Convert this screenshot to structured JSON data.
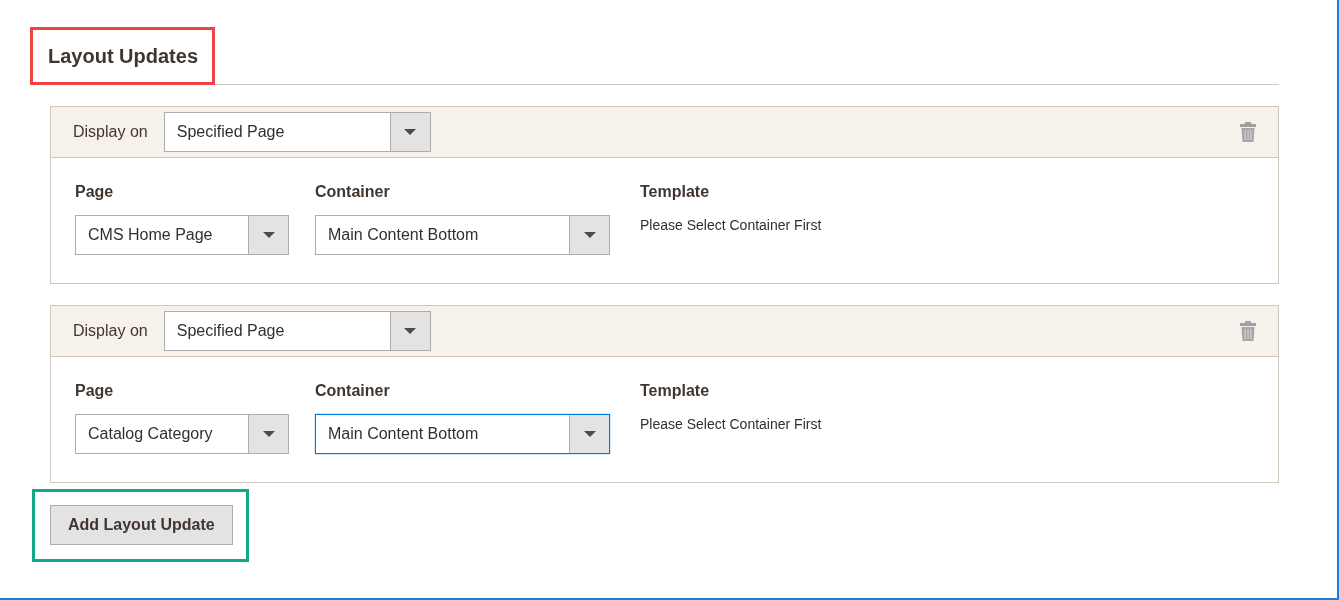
{
  "section": {
    "title": "Layout Updates",
    "title_highlight": {
      "color": "#ef4444"
    }
  },
  "layout_updates": [
    {
      "display_on": {
        "label": "Display on",
        "value": "Specified Page"
      },
      "fields": [
        {
          "label": "Page",
          "value": "CMS Home Page",
          "focused": false
        },
        {
          "label": "Container",
          "value": "Main Content Bottom",
          "focused": false
        }
      ],
      "template": {
        "label": "Template",
        "text": "Please Select Container First"
      }
    },
    {
      "display_on": {
        "label": "Display on",
        "value": "Specified Page"
      },
      "fields": [
        {
          "label": "Page",
          "value": "Catalog Category",
          "focused": false
        },
        {
          "label": "Container",
          "value": "Main Content Bottom",
          "focused": true
        }
      ],
      "template": {
        "label": "Template",
        "text": "Please Select Container First"
      }
    }
  ],
  "add_button": {
    "label": "Add Layout Update",
    "highlight": {
      "color": "#14a88a"
    }
  }
}
